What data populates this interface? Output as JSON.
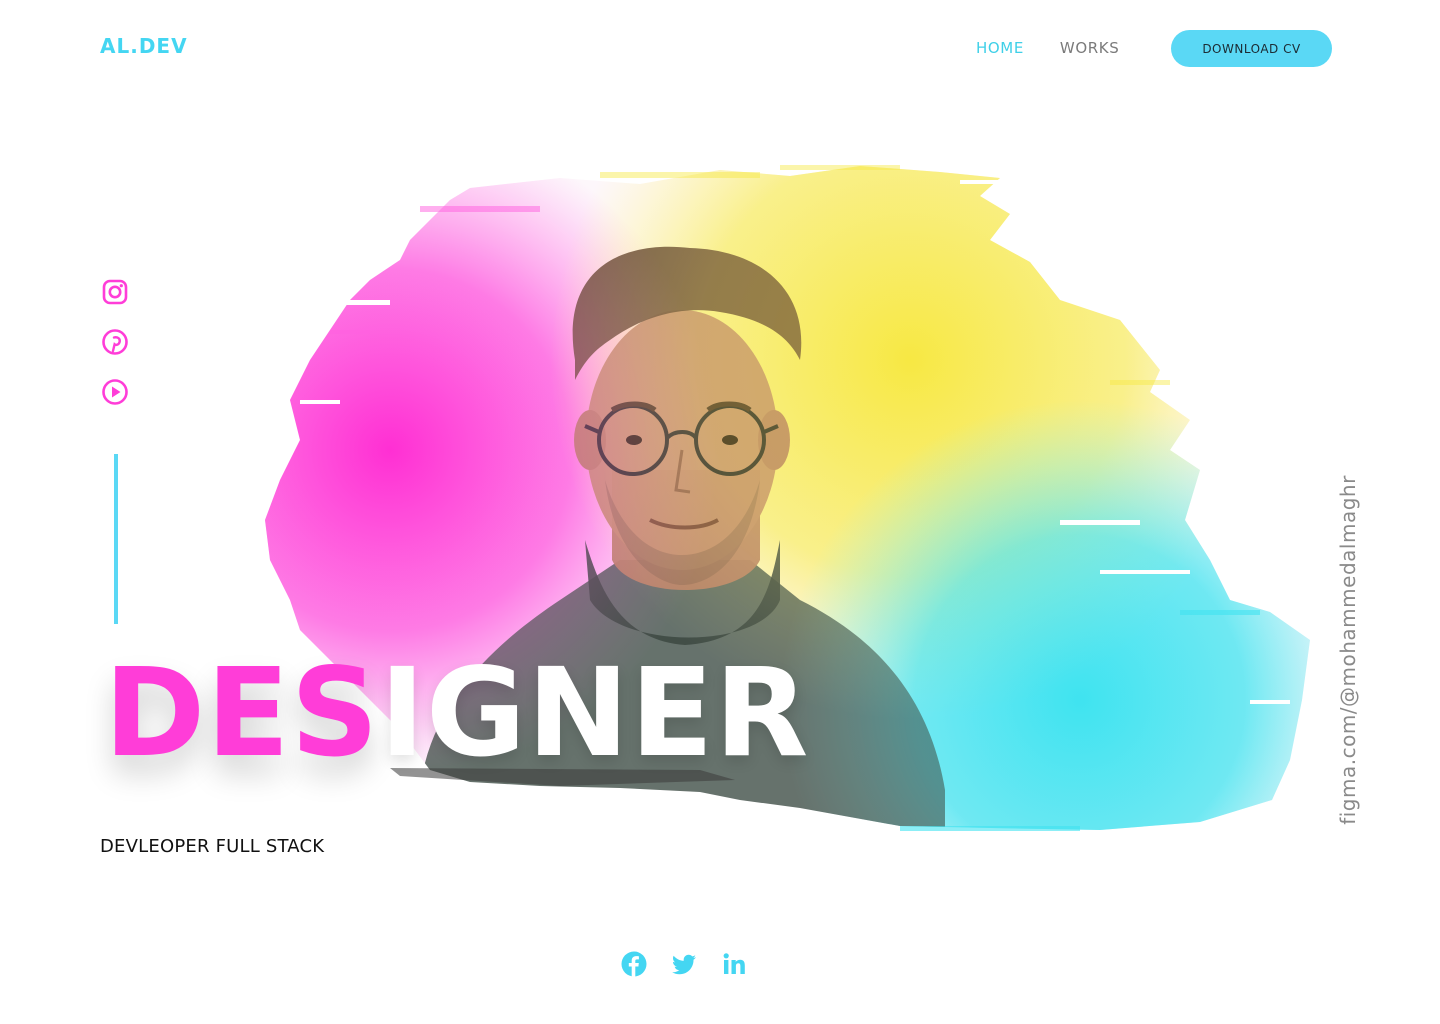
{
  "header": {
    "logo": "AL.DEV",
    "nav": [
      {
        "label": "HOME",
        "active": true
      },
      {
        "label": "WORKS",
        "active": false
      }
    ],
    "cta_label": "DOWNLOAD CV"
  },
  "hero": {
    "title_highlight": "DES",
    "title_rest": "IGNER",
    "subtitle": "DEVLEOPER FULL STACK",
    "credit": "figma.com/@mohammedalmaghr"
  },
  "side_social": [
    {
      "icon": "instagram-icon"
    },
    {
      "icon": "pinterest-icon"
    },
    {
      "icon": "youtube-icon"
    }
  ],
  "bottom_social": [
    {
      "icon": "facebook-icon"
    },
    {
      "icon": "twitter-icon"
    },
    {
      "icon": "linkedin-icon"
    }
  ],
  "colors": {
    "accent_cyan": "#5ad8f5",
    "accent_pink": "#ff3dd8",
    "splash_yellow": "#f7ea4a",
    "text_dark": "#111111",
    "text_muted": "#7b7b7b"
  }
}
